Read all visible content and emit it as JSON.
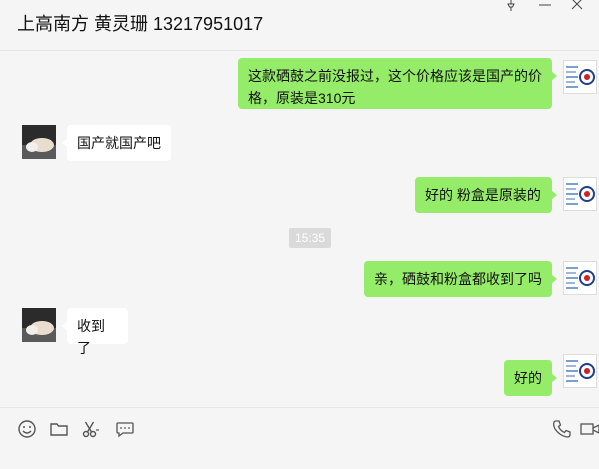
{
  "window": {
    "title": "上高南方 黄灵珊 13217951017",
    "controls": [
      "pin-icon",
      "minimize-icon",
      "close-icon"
    ]
  },
  "messages": [
    {
      "direction": "out",
      "text": "这款硒鼓之前没报过，这个价格应该是国产的价格，原装是310元"
    },
    {
      "direction": "in",
      "text": "国产就国产吧"
    },
    {
      "direction": "out",
      "text": "好的 粉盒是原装的"
    },
    {
      "direction": "time",
      "text": "15:35"
    },
    {
      "direction": "out",
      "text": "亲，硒鼓和粉盒都收到了吗"
    },
    {
      "direction": "in",
      "text": "收到了"
    },
    {
      "direction": "out",
      "text": "好的"
    }
  ],
  "toolbar": {
    "left_icons": [
      "emoji-icon",
      "folder-icon",
      "scissors-icon",
      "chat-bubble-icon"
    ],
    "right_icons": [
      "phone-icon",
      "video-icon"
    ]
  },
  "colors": {
    "bubble_out": "#95ec69",
    "bubble_in": "#ffffff",
    "background": "#f5f5f5"
  }
}
